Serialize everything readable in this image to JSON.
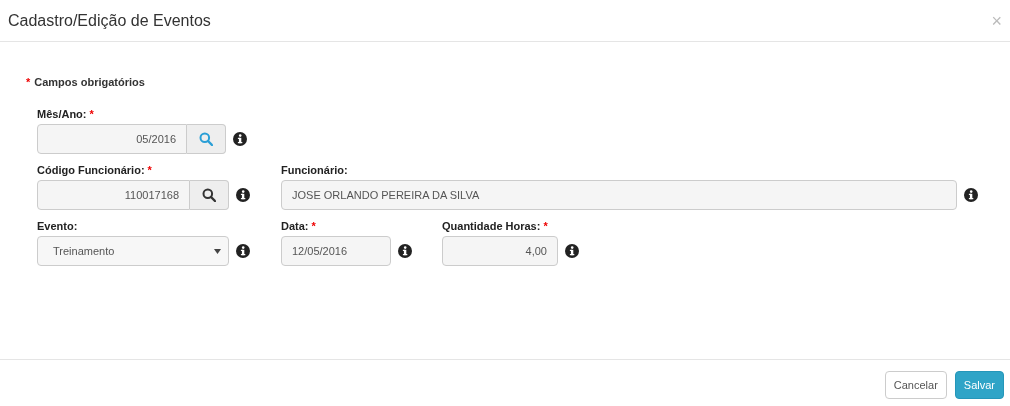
{
  "window": {
    "title": "Cadastro/Edição de Eventos",
    "close": "×"
  },
  "required_note": {
    "mark": "*",
    "text": "Campos obrigatórios"
  },
  "rows": [
    {
      "fields": [
        {
          "kind": "lookup",
          "label": "Mês/Ano:",
          "required_mark": "*",
          "value": "05/2016",
          "color": "#2a9fd6"
        }
      ]
    },
    {
      "fields": [
        {
          "kind": "lookup",
          "label": "Código Funcionário:",
          "required_mark": "*",
          "value": "110017168",
          "color": "#333333"
        },
        {
          "kind": "text",
          "label": "Funcionário:",
          "value": "JOSE ORLANDO PEREIRA DA SILVA"
        }
      ]
    },
    {
      "fields": [
        {
          "kind": "select",
          "label": "Evento:",
          "value": "Treinamento"
        },
        {
          "kind": "text",
          "label": "Data:",
          "required_mark": "*",
          "value": "12/05/2016"
        },
        {
          "kind": "number",
          "label": "Quantidade Horas:",
          "required_mark": "*",
          "value": "4,00"
        }
      ]
    }
  ],
  "buttons": [
    {
      "label": "Cancelar",
      "kind": "default"
    },
    {
      "label": "Salvar",
      "kind": "primary"
    }
  ]
}
